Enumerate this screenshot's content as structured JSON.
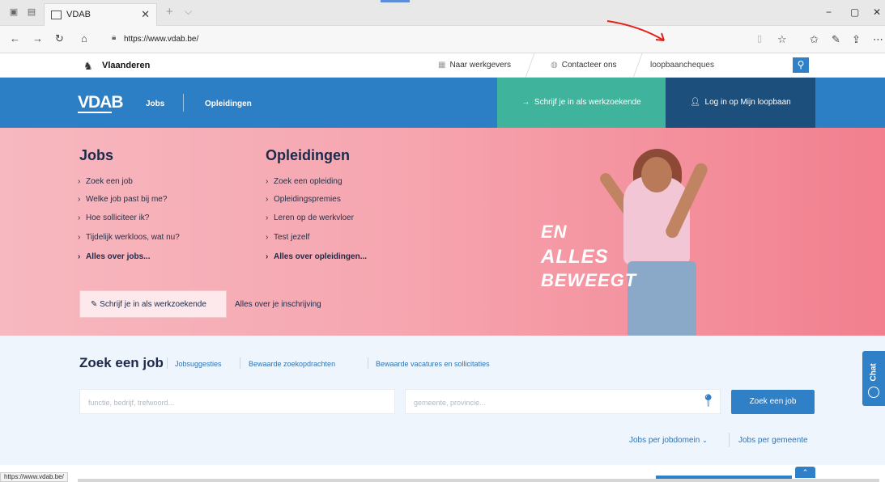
{
  "browser": {
    "tab_title": "VDAB",
    "tab_close": "✕",
    "new_tab": "+",
    "tab_menu": "⌵",
    "url": "https://www.vdab.be/",
    "window_controls": [
      "−",
      "▢",
      "✕"
    ],
    "status_url": "https://www.vdab.be/"
  },
  "site_topbar": {
    "brand": "Vlaanderen",
    "link_employers": "Naar werkgevers",
    "link_contact": "Contacteer ons",
    "search_value": "loopbaancheques"
  },
  "header": {
    "logo": "VDAB",
    "nav": [
      "Jobs",
      "Opleidingen"
    ],
    "register_button": "Schrijf je in als werkzoekende",
    "login_button": "Log in op Mijn loopbaan"
  },
  "hero": {
    "jobs": {
      "title": "Jobs",
      "links": [
        "Zoek een job",
        "Welke job past bij me?",
        "Hoe solliciteer ik?",
        "Tijdelijk werkloos, wat nu?"
      ],
      "more": "Alles over jobs..."
    },
    "opleidingen": {
      "title": "Opleidingen",
      "links": [
        "Zoek een opleiding",
        "Opleidingspremies",
        "Leren op de werkvloer",
        "Test jezelf"
      ],
      "more": "Alles over opleidingen..."
    },
    "register_button": "Schrijf je in als werkzoekende",
    "register_link": "Alles over je inschrijving",
    "slogan": [
      "EN",
      "ALLES",
      "BEWEEGT"
    ]
  },
  "search": {
    "title": "Zoek een job",
    "tabs": [
      "Jobsuggesties",
      "Bewaarde zoekopdrachten",
      "Bewaarde vacatures en sollicitaties"
    ],
    "keyword_placeholder": "functie, bedrijf, trefwoord...",
    "location_placeholder": "gemeente, provincie...",
    "submit": "Zoek een job",
    "footer_links": [
      "Jobs per jobdomein",
      "Jobs per gemeente"
    ]
  },
  "chat": {
    "label": "Chat"
  },
  "colors": {
    "brand_blue": "#2c7fc4",
    "green": "#3fb39b",
    "dark_blue": "#1d4f7c",
    "hero_pink": "#f27f8e"
  }
}
